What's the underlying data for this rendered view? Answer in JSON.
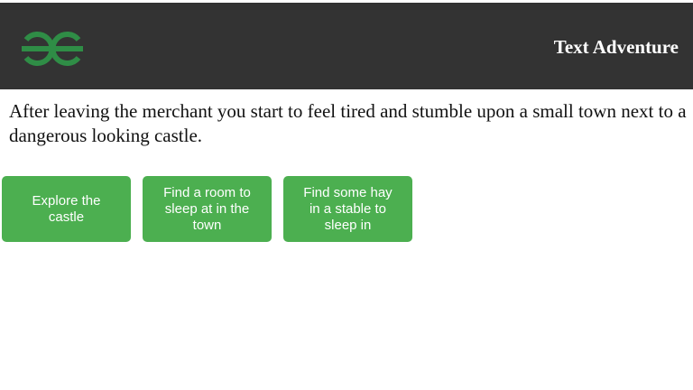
{
  "header": {
    "logo_icon": "gfg-logo-icon",
    "logo_color": "#2f8d46",
    "title": "Text Adventure",
    "background": "#333333"
  },
  "story": {
    "text": "After leaving the merchant you start to feel tired and stumble upon a small town next to a dangerous looking castle."
  },
  "choices": [
    {
      "label": "Explore the castle"
    },
    {
      "label": "Find a room to sleep at in the town"
    },
    {
      "label": "Find some hay in a stable to sleep in"
    }
  ],
  "colors": {
    "button": "#4caf50",
    "button_text": "#ffffff"
  }
}
